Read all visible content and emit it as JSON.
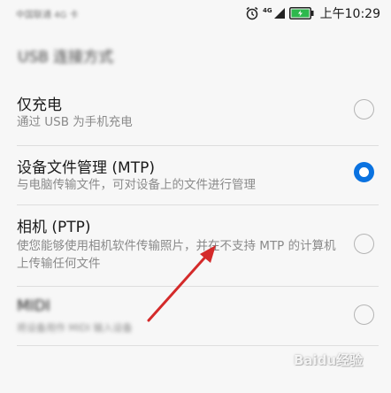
{
  "status_bar": {
    "carrier": "中国联通 4G 卡",
    "network": "4G",
    "time": "上午10:29",
    "battery_color": "#2db84d"
  },
  "section_title": "USB 连接方式",
  "options": [
    {
      "label": "仅充电",
      "description": "通过 USB 为手机充电",
      "selected": false
    },
    {
      "label": "设备文件管理 (MTP)",
      "description": "与电脑传输文件，可对设备上的文件进行管理",
      "selected": true
    },
    {
      "label": "相机 (PTP)",
      "description": "使您能够使用相机软件传输照片，并在不支持 MTP 的计算机上传输任何文件",
      "selected": false
    },
    {
      "label": "MIDI",
      "description": "将设备用作 MIDI 输入设备",
      "selected": false
    }
  ],
  "colors": {
    "accent": "#0a72e0",
    "arrow": "#d42a2a"
  },
  "watermark": "Baidu经验"
}
